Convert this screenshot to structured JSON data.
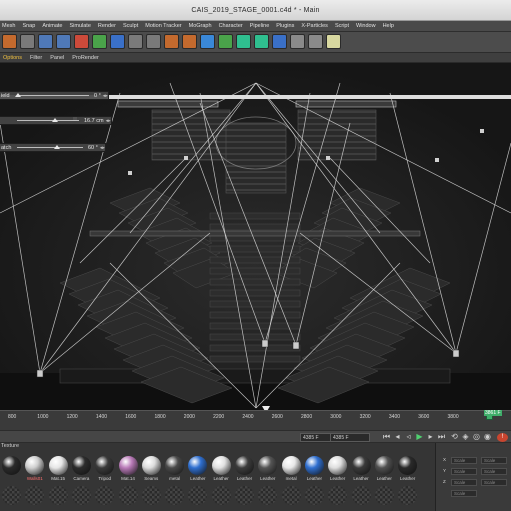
{
  "window": {
    "title": "CAIS_2019_STAGE_0001.c4d * - Main"
  },
  "menubar": {
    "items": [
      "Mesh",
      "Snap",
      "Animate",
      "Simulate",
      "Render",
      "Sculpt",
      "Motion Tracker",
      "MoGraph",
      "Character",
      "Pipeline",
      "Plugins",
      "X-Particles",
      "Script",
      "Window",
      "Help"
    ]
  },
  "toolbar": {
    "icons": [
      "undo-icon",
      "move-icon",
      "scale-icon",
      "rotate-icon",
      "x-axis-icon",
      "y-axis-icon",
      "z-axis-icon",
      "coordinate-system-icon",
      "render-region-icon",
      "render-view-icon",
      "render-settings-icon",
      "cube-icon",
      "pen-icon",
      "subdivision-icon",
      "array-icon",
      "deformer-icon",
      "floor-icon",
      "camera-icon",
      "light-icon"
    ]
  },
  "viewmenu": {
    "items": [
      "Options",
      "Filter",
      "Panel",
      "ProRender"
    ]
  },
  "hud": {
    "rows": [
      {
        "label": "ield",
        "value": "0 °",
        "level": 0.02
      },
      {
        "label": "",
        "value": "16.7 cm",
        "level": 0.62
      },
      {
        "label": "atch",
        "value": "60 °",
        "level": 0.6
      }
    ]
  },
  "timeline": {
    "ticks": [
      "800",
      "1000",
      "1200",
      "1400",
      "1600",
      "1800",
      "2000",
      "2200",
      "2400",
      "2600",
      "2800",
      "3000",
      "3200",
      "3400",
      "3600",
      "3800"
    ],
    "current_frame": "3861 F",
    "end_field": "4385 F",
    "current_field": "4385 F"
  },
  "materials": {
    "menu": "Texture",
    "items": [
      {
        "name": "",
        "color": "#2a2a2a"
      },
      {
        "name": "Walls01",
        "color": "#cfcfcf",
        "selected": true
      },
      {
        "name": "Mat.15",
        "color": "#e6e6e6"
      },
      {
        "name": "Camera",
        "color": "#2c2c2c"
      },
      {
        "name": "Tripod",
        "color": "#3a3a3a"
      },
      {
        "name": "Mat.14",
        "color": "#b97ab8"
      },
      {
        "name": "Seams",
        "color": "#dcdcdc"
      },
      {
        "name": "metal",
        "color": "#4a4a4a"
      },
      {
        "name": "Leather",
        "color": "#2f6fd0"
      },
      {
        "name": "Leather",
        "color": "#e0e0e0"
      },
      {
        "name": "Leather",
        "color": "#3c3c3c"
      },
      {
        "name": "Leather",
        "color": "#555555"
      },
      {
        "name": "metal",
        "color": "#e8e8e8"
      },
      {
        "name": "Leather",
        "color": "#2f6fd0"
      },
      {
        "name": "Leather",
        "color": "#dedede"
      },
      {
        "name": "Leather",
        "color": "#3a3a3a"
      },
      {
        "name": "Leather",
        "color": "#505050"
      },
      {
        "name": "Leather",
        "color": "#2a2a2a"
      }
    ]
  },
  "attributes": {
    "rows": [
      {
        "axis": "X",
        "a": "Scale",
        "b": "Scale"
      },
      {
        "axis": "Y",
        "a": "Scale",
        "b": "Scale"
      },
      {
        "axis": "Z",
        "a": "Scale",
        "b": "Scale"
      },
      {
        "axis": "",
        "a": "Scale",
        "b": ""
      }
    ]
  },
  "colors": {
    "accent": "#f0c040",
    "playhead": "#3fae6a",
    "viewport_bg": "#1b1b1b"
  }
}
